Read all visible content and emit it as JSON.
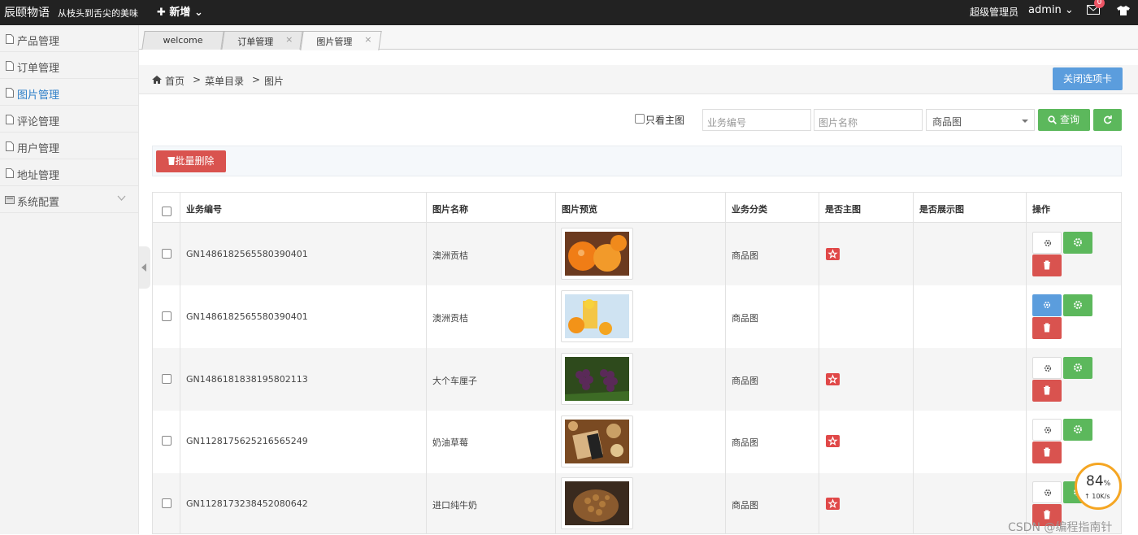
{
  "topbar": {
    "brand": "辰颐物语",
    "slogan": "从枝头到舌尖的美味",
    "new_label": "✚ 新增 ⌄",
    "role": "超级管理员",
    "user": "admin ⌄",
    "mail_badge": "0"
  },
  "sidebar": {
    "items": [
      {
        "label": "产品管理",
        "icon": "file-icon"
      },
      {
        "label": "订单管理",
        "icon": "file-icon"
      },
      {
        "label": "图片管理",
        "icon": "file-icon",
        "active": true
      },
      {
        "label": "评论管理",
        "icon": "file-icon"
      },
      {
        "label": "用户管理",
        "icon": "file-icon"
      },
      {
        "label": "地址管理",
        "icon": "file-icon"
      },
      {
        "label": "系统配置",
        "icon": "config-icon",
        "expandable": true
      }
    ]
  },
  "tabs": [
    {
      "label": "welcome"
    },
    {
      "label": "订单管理"
    },
    {
      "label": "图片管理",
      "active": true
    }
  ],
  "breadcrumb": {
    "home": "首页",
    "sep1": ">",
    "menu": "菜单目录",
    "sep2": ">",
    "current": "图片"
  },
  "close_tab_label": "关闭选项卡",
  "filters": {
    "main_only_label": "只看主图",
    "biz_no_placeholder": "业务编号",
    "img_name_placeholder": "图片名称",
    "category_value": "商品图",
    "query_label": "查询"
  },
  "batch_delete_label": "批量删除",
  "table": {
    "headers": [
      "业务编号",
      "图片名称",
      "图片预览",
      "业务分类",
      "是否主图",
      "是否展示图",
      "操作"
    ],
    "rows": [
      {
        "biz_no": "GN1486182565580390401",
        "name": "澳洲贡桔",
        "preview": "oranges",
        "category": "商品图",
        "is_main": true
      },
      {
        "biz_no": "GN1486182565580390401",
        "name": "澳洲贡桔",
        "preview": "orange-juice",
        "category": "商品图",
        "is_main": false
      },
      {
        "biz_no": "GN1486181838195802113",
        "name": "大个车厘子",
        "preview": "grapes",
        "category": "商品图",
        "is_main": true
      },
      {
        "biz_no": "GN1128175625216565249",
        "name": "奶油草莓",
        "preview": "snacks",
        "category": "商品图",
        "is_main": true
      },
      {
        "biz_no": "GN1128173238452080642",
        "name": "进口纯牛奶",
        "preview": "nuts",
        "category": "商品图",
        "is_main": true
      }
    ]
  },
  "speed_widget": {
    "percent": "84",
    "unit": "%",
    "rate": "↑ 10K/s"
  },
  "watermark": "CSDN @编程指南针"
}
